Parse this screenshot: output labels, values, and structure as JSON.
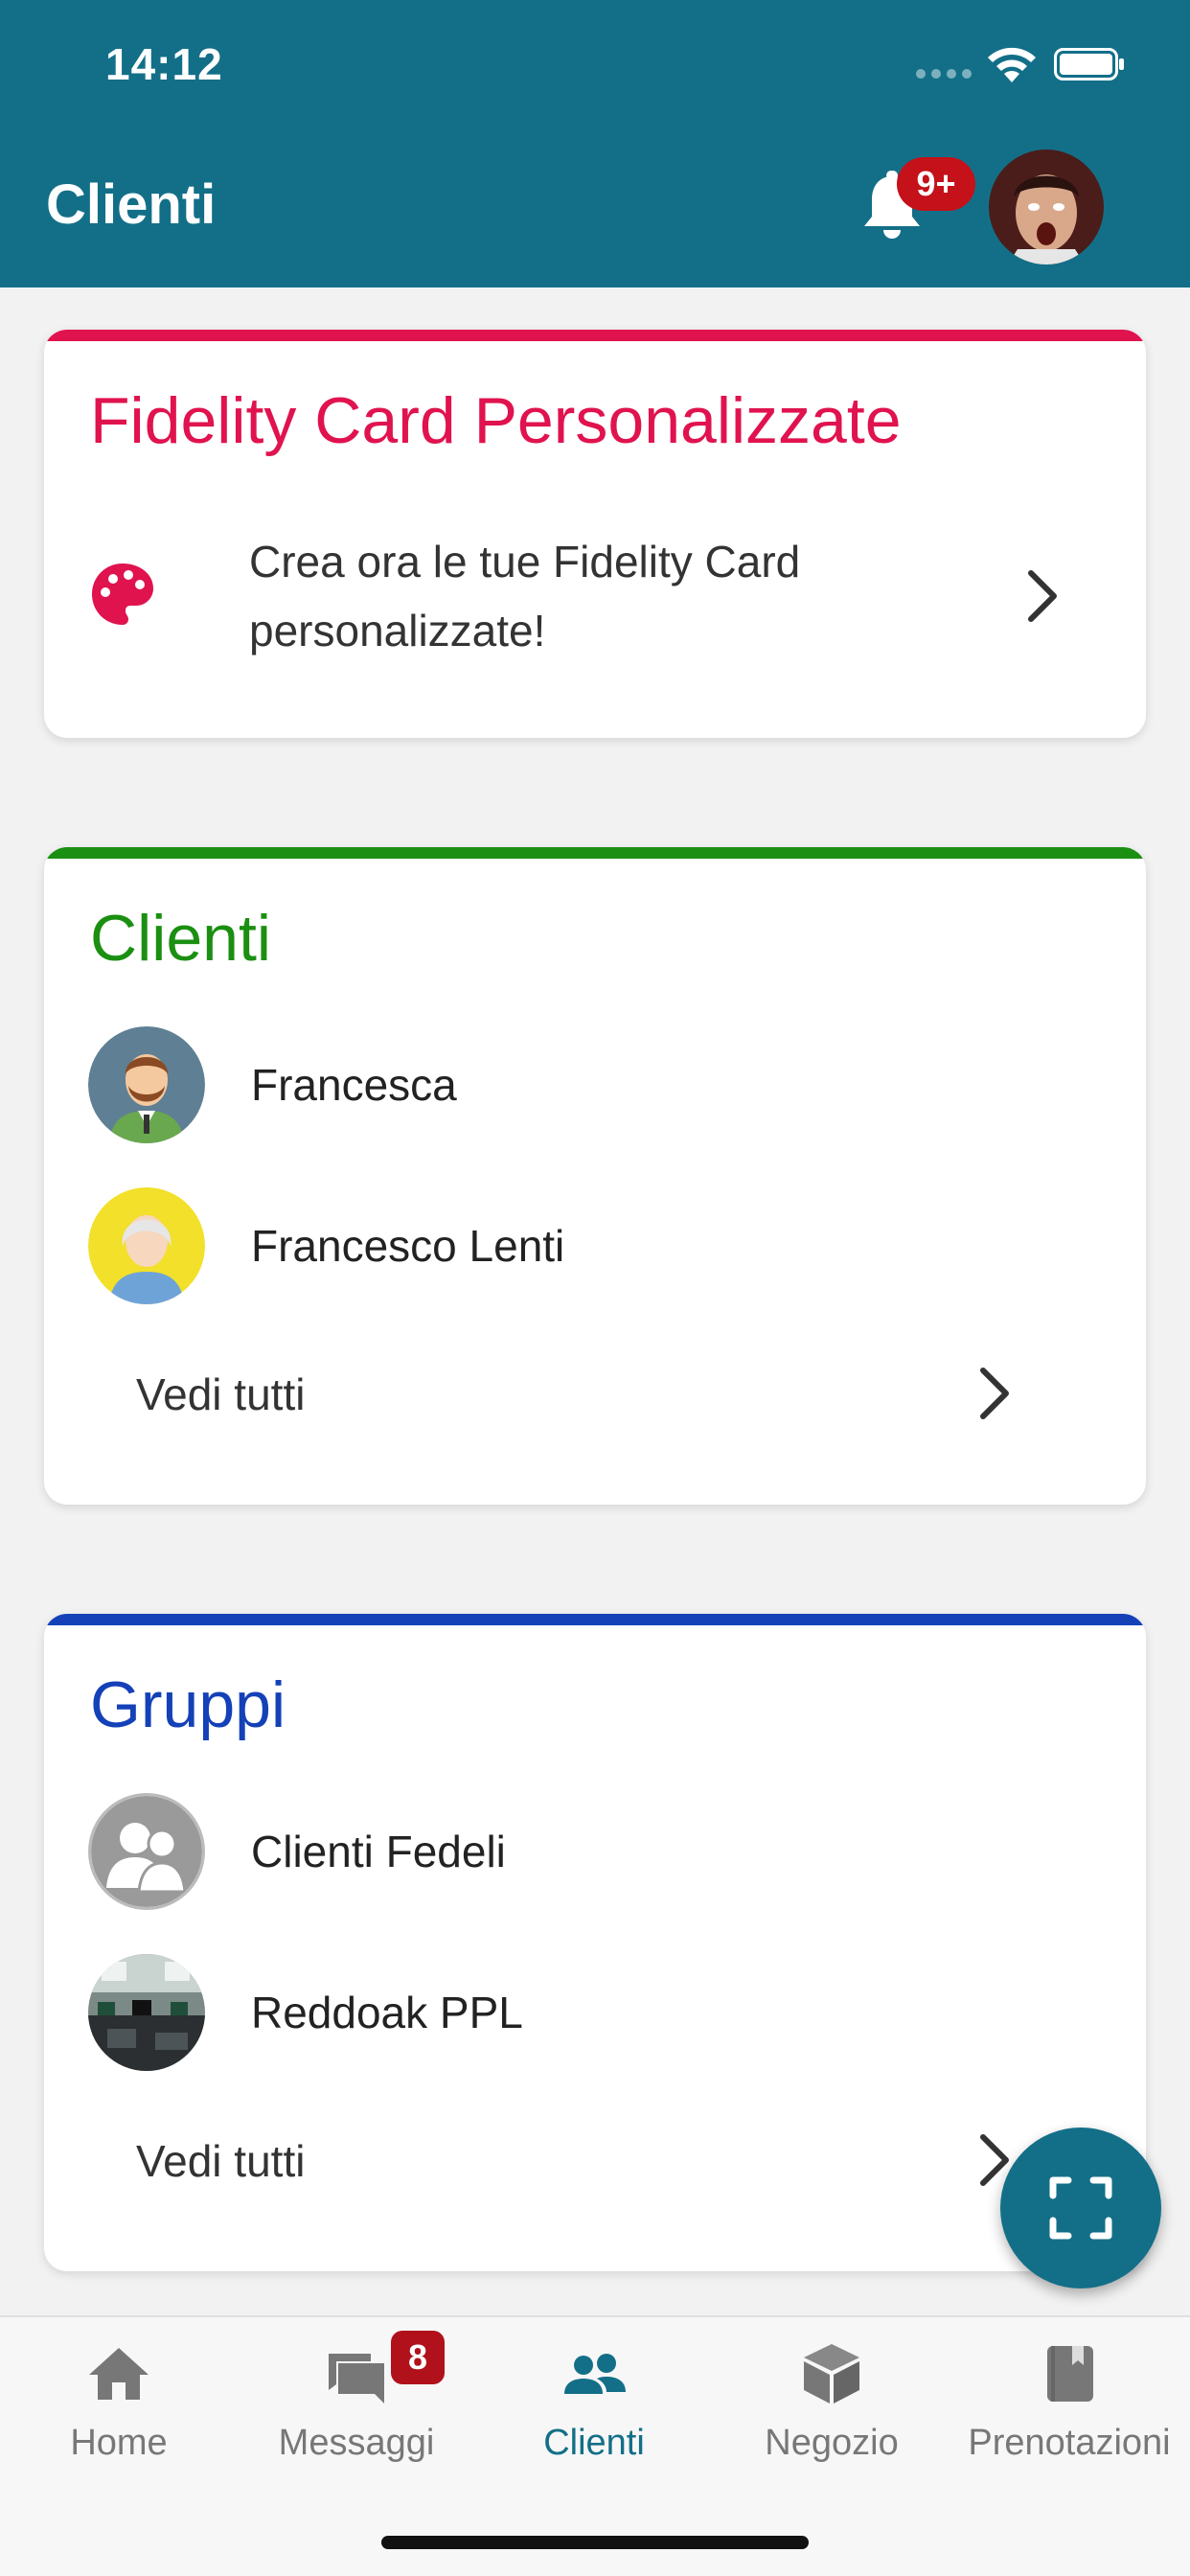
{
  "status_bar": {
    "time": "14:12"
  },
  "header": {
    "title": "Clienti",
    "notification_count": "9+"
  },
  "fidelity_card": {
    "title": "Fidelity Card Personalizzate",
    "description_line1": "Crea ora le tue Fidelity Card",
    "description_line2": "personalizzate!",
    "accent": "#e0134f"
  },
  "clients_card": {
    "title": "Clienti",
    "accent": "#1b8f12",
    "items": [
      {
        "name": "Francesca"
      },
      {
        "name": "Francesco Lenti"
      }
    ],
    "see_all": "Vedi tutti"
  },
  "groups_card": {
    "title": "Gruppi",
    "accent": "#1441b8",
    "items": [
      {
        "name": "Clienti Fedeli"
      },
      {
        "name": "Reddoak PPL"
      }
    ],
    "see_all": "Vedi tutti"
  },
  "tabbar": {
    "items": [
      {
        "label": "Home",
        "icon": "home-icon"
      },
      {
        "label": "Messaggi",
        "icon": "messages-icon",
        "badge": "8"
      },
      {
        "label": "Clienti",
        "icon": "people-icon"
      },
      {
        "label": "Negozio",
        "icon": "box-icon"
      },
      {
        "label": "Prenotazioni",
        "icon": "book-icon"
      }
    ],
    "active": "Clienti"
  },
  "colors": {
    "primary": "#136f88",
    "badge": "#c4111a"
  }
}
